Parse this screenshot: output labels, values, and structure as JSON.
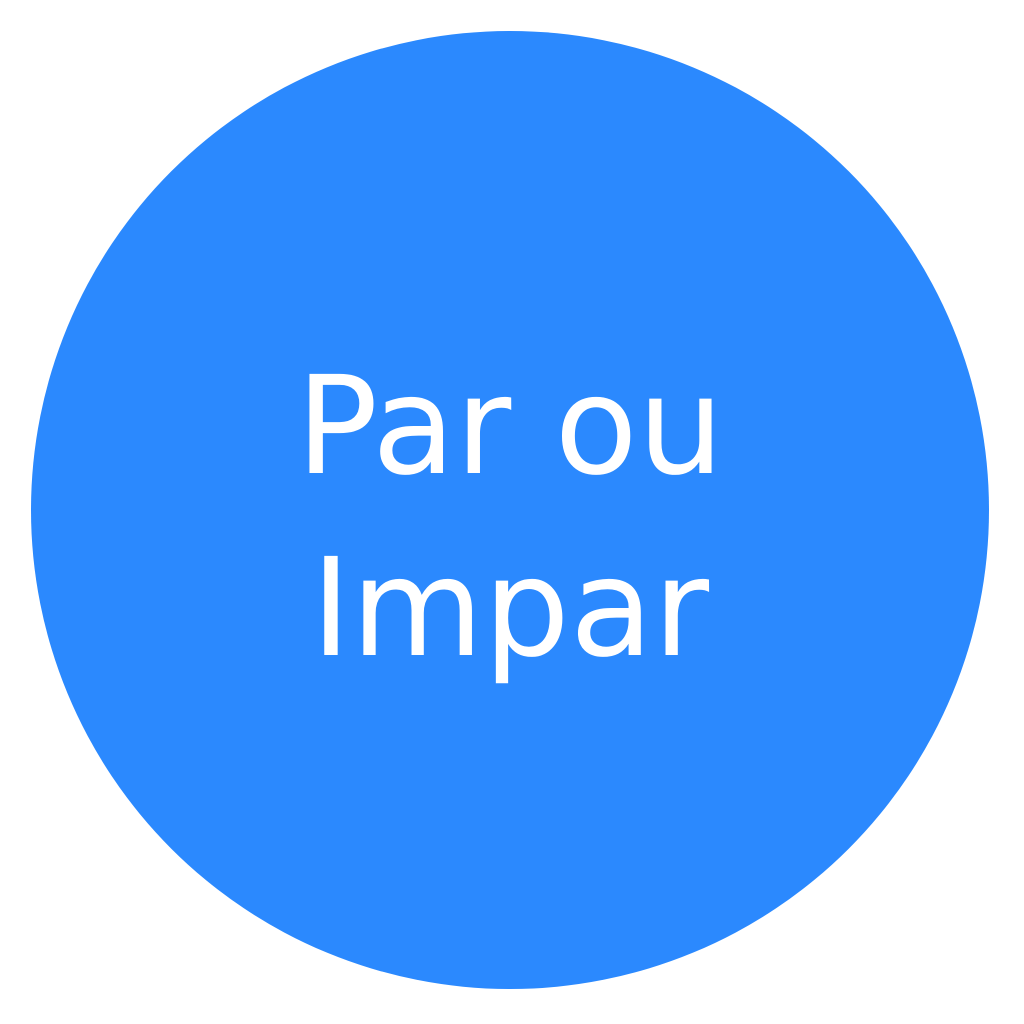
{
  "app": {
    "title_lines": [
      "Par ou",
      "Impar"
    ],
    "colors": {
      "background": "#ffffff",
      "circle": "#2b89fe",
      "text": "#ffffff"
    }
  }
}
